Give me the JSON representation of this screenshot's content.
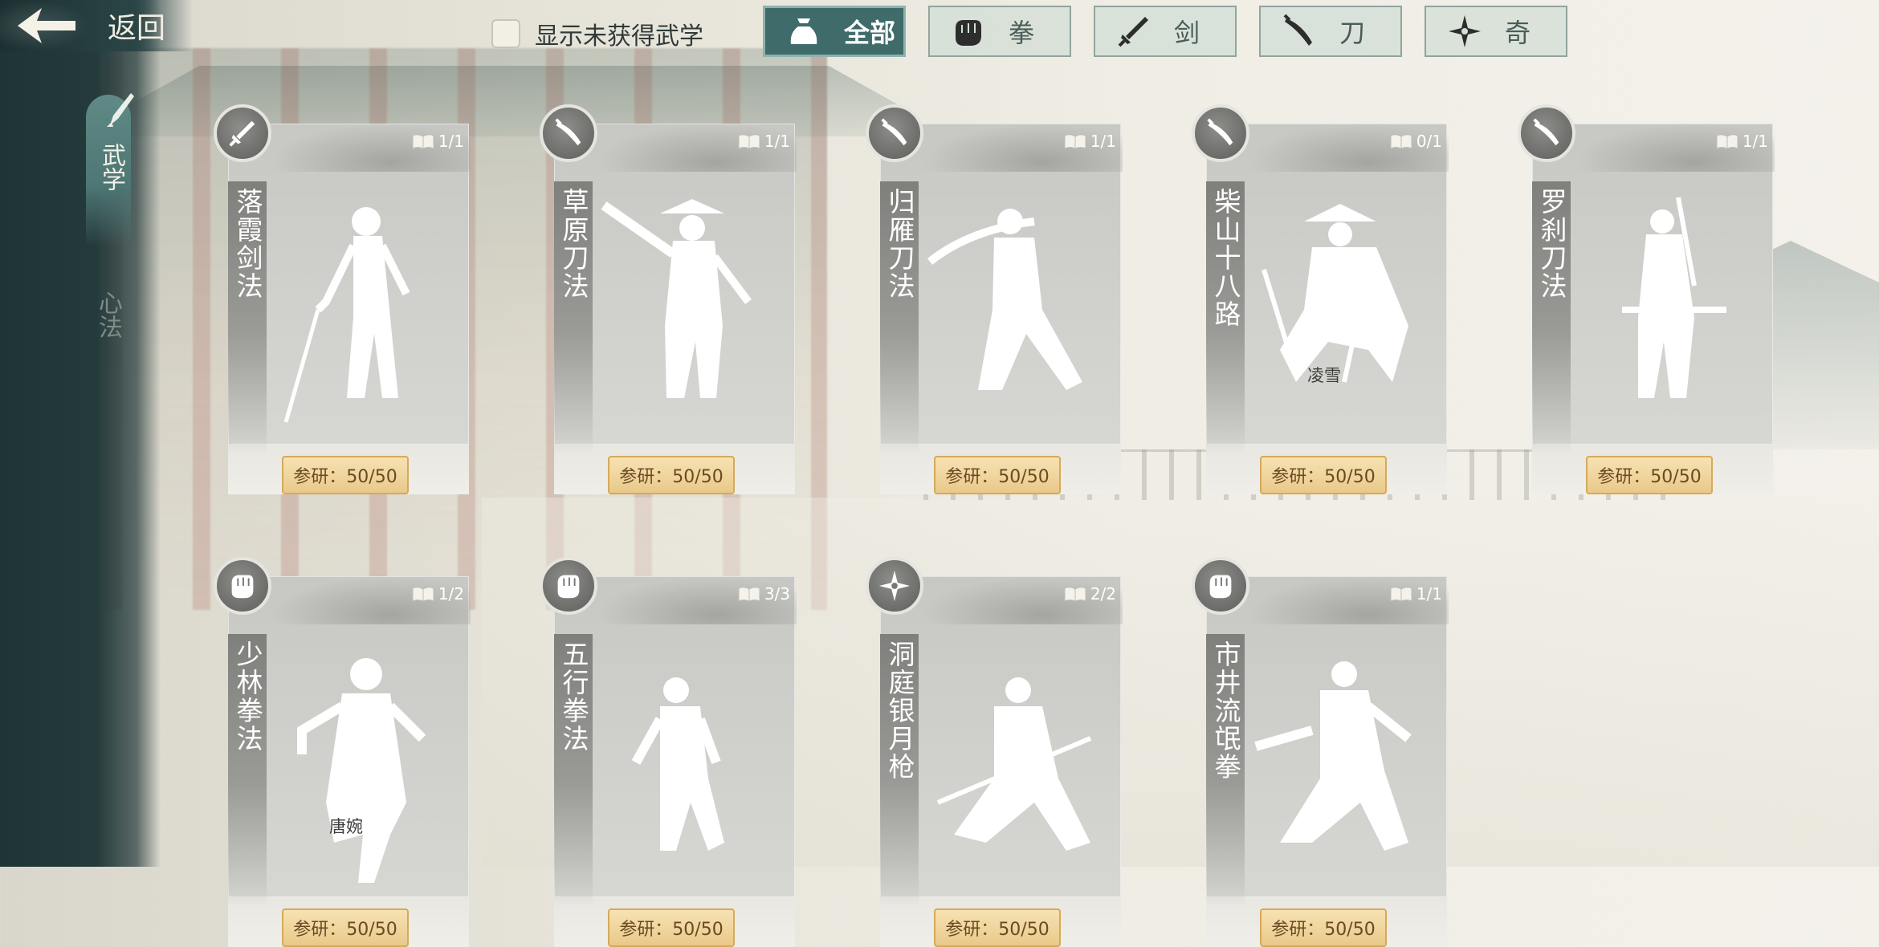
{
  "header": {
    "back_label": "返回",
    "toggle_label": "显示未获得武学",
    "toggle_checked": false
  },
  "sidebar": {
    "items": [
      {
        "label": "武学",
        "active": true
      },
      {
        "label": "心法",
        "active": false
      }
    ]
  },
  "tabs": [
    {
      "label": "全部",
      "icon": "bag-icon",
      "active": true
    },
    {
      "label": "拳",
      "icon": "fist-icon",
      "active": false
    },
    {
      "label": "剑",
      "icon": "sword-icon",
      "active": false
    },
    {
      "label": "刀",
      "icon": "saber-icon",
      "active": false
    },
    {
      "label": "奇",
      "icon": "shuriken-icon",
      "active": false
    }
  ],
  "cards": [
    {
      "name": "落霞剑法",
      "type_icon": "sword-icon",
      "count": "1/1",
      "owner": "",
      "research": "参研：50/50"
    },
    {
      "name": "草原刀法",
      "type_icon": "saber-icon",
      "count": "1/1",
      "owner": "",
      "research": "参研：50/50"
    },
    {
      "name": "归雁刀法",
      "type_icon": "saber-icon",
      "count": "1/1",
      "owner": "",
      "research": "参研：50/50"
    },
    {
      "name": "柴山十八路",
      "type_icon": "saber-icon",
      "count": "0/1",
      "owner": "凌雪",
      "research": "参研：50/50"
    },
    {
      "name": "罗刹刀法",
      "type_icon": "saber-icon",
      "count": "1/1",
      "owner": "",
      "research": "参研：50/50"
    },
    {
      "name": "少林拳法",
      "type_icon": "fist-icon",
      "count": "1/2",
      "owner": "唐婉",
      "research": "参研：50/50"
    },
    {
      "name": "五行拳法",
      "type_icon": "fist-icon",
      "count": "3/3",
      "owner": "",
      "research": "参研：50/50"
    },
    {
      "name": "洞庭银月枪",
      "type_icon": "shuriken-icon",
      "count": "2/2",
      "owner": "",
      "research": "参研：50/50"
    },
    {
      "name": "市井流氓拳",
      "type_icon": "fist-icon",
      "count": "1/1",
      "owner": "",
      "research": "参研：50/50"
    }
  ],
  "colors": {
    "sidebar": "#243a3b",
    "active_tab": "#3f6b6a",
    "research_badge": "#e9c98a"
  }
}
